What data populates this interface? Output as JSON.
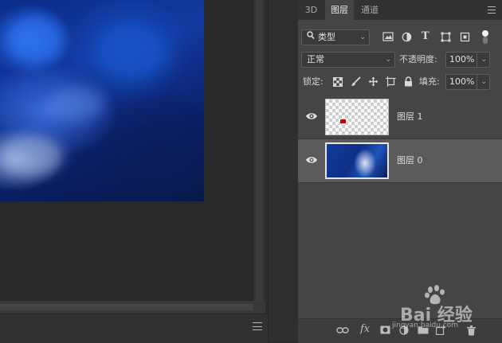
{
  "tabs": [
    {
      "label": "3D"
    },
    {
      "label": "图层"
    },
    {
      "label": "通道"
    }
  ],
  "filter": {
    "label": "类型"
  },
  "blend": {
    "mode": "正常",
    "opacity_label": "不透明度:",
    "opacity_value": "100%"
  },
  "lock": {
    "label": "锁定:",
    "fill_label": "填充:",
    "fill_value": "100%"
  },
  "layers": [
    {
      "name": "图层 1",
      "visible": true,
      "selected": false
    },
    {
      "name": "图层 0",
      "visible": true,
      "selected": true
    }
  ],
  "footer": {
    "fx_label": "fx"
  },
  "watermark": {
    "text": "Bai 经验",
    "sub": "jingyan.baidu.com"
  },
  "colors": {
    "panel": "#454545",
    "selected_row": "#5b5b5b",
    "canvas_blue": "#12389f"
  }
}
